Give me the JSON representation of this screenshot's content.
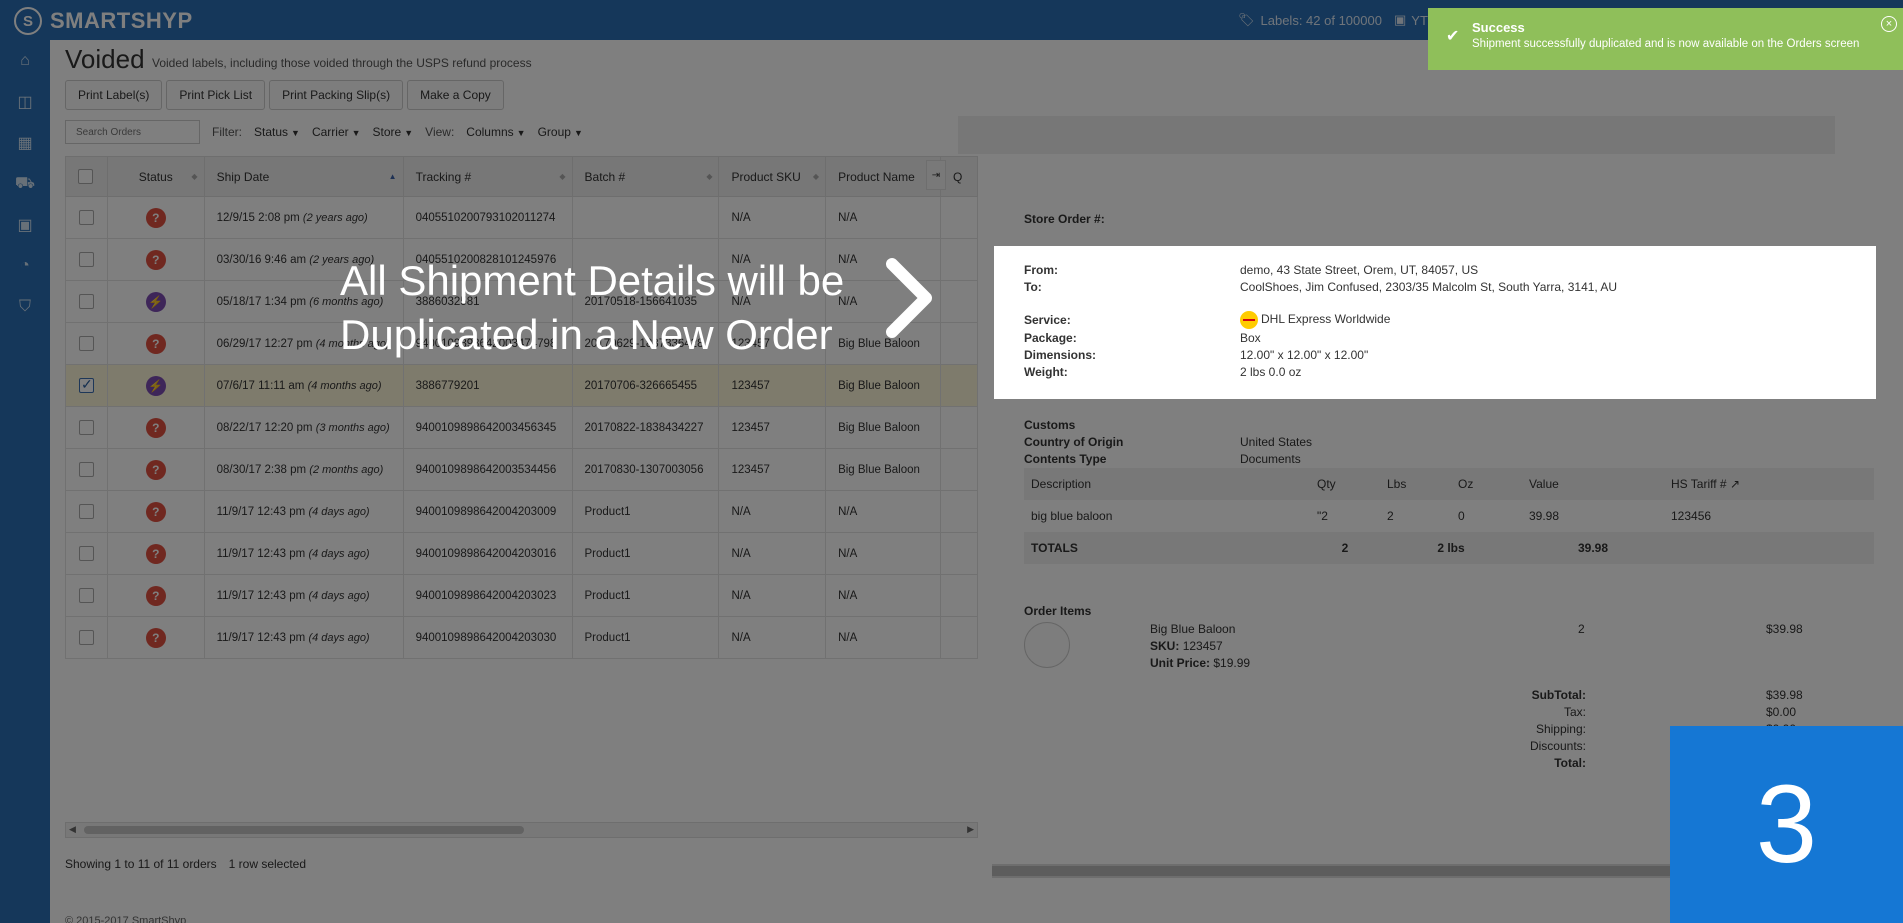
{
  "app": {
    "logo_mark": "S",
    "brand": "SMARTSHYP",
    "labels_count": "Labels: 42 of 100000",
    "cash": "YT",
    "copyright": "© 2015-2017 SmartShyp"
  },
  "sidebar": {
    "items": [
      {
        "name": "home-icon",
        "glyph": "⌂"
      },
      {
        "name": "basket-icon",
        "glyph": "◫"
      },
      {
        "name": "calendar-icon",
        "glyph": "▦"
      },
      {
        "name": "truck-icon",
        "glyph": "⛟"
      },
      {
        "name": "address-book-icon",
        "glyph": "▣"
      },
      {
        "name": "pie-chart-icon",
        "glyph": "◔"
      },
      {
        "name": "cart-icon",
        "glyph": "⛉"
      }
    ]
  },
  "page": {
    "title": "Voided",
    "subtitle": "Voided labels, including those voided through the USPS refund process"
  },
  "toolbar": {
    "print_labels": "Print Label(s)",
    "print_pick": "Print Pick List",
    "print_packing": "Print Packing Slip(s)",
    "make_copy": "Make a Copy"
  },
  "filters": {
    "search_placeholder": "Search Orders",
    "filter_label": "Filter:",
    "status": "Status",
    "carrier": "Carrier",
    "store": "Store",
    "view_label": "View:",
    "columns": "Columns",
    "group": "Group"
  },
  "grid": {
    "headers": [
      "Status",
      "Ship Date",
      "Tracking #",
      "Batch #",
      "Product SKU",
      "Product Name",
      "Q"
    ],
    "rows": [
      {
        "status": "void",
        "date": "12/9/15 2:08 pm",
        "ago": "(2 years ago)",
        "tracking": "0405510200793102011274",
        "batch": "",
        "sku": "N/A",
        "name": "N/A",
        "selected": false
      },
      {
        "status": "void",
        "date": "03/30/16 9:46 am",
        "ago": "(2 years ago)",
        "tracking": "0405510200828101245976",
        "batch": "",
        "sku": "N/A",
        "name": "N/A",
        "selected": false
      },
      {
        "status": "lightning",
        "date": "05/18/17 1:34 pm",
        "ago": "(6 months ago)",
        "tracking": "3886032581",
        "batch": "20170518-156641035",
        "sku": "N/A",
        "name": "N/A",
        "selected": false
      },
      {
        "status": "void",
        "date": "06/29/17 12:27 pm",
        "ago": "(4 months ago)",
        "tracking": "9400109898642003474798",
        "batch": "20170629-1837336428",
        "sku": "123457",
        "name": "Big Blue Baloon",
        "selected": false
      },
      {
        "status": "lightning",
        "date": "07/6/17 11:11 am",
        "ago": "(4 months ago)",
        "tracking": "3886779201",
        "batch": "20170706-326665455",
        "sku": "123457",
        "name": "Big Blue Baloon",
        "selected": true
      },
      {
        "status": "void",
        "date": "08/22/17 12:20 pm",
        "ago": "(3 months ago)",
        "tracking": "9400109898642003456345",
        "batch": "20170822-1838434227",
        "sku": "123457",
        "name": "Big Blue Baloon",
        "selected": false
      },
      {
        "status": "void",
        "date": "08/30/17 2:38 pm",
        "ago": "(2 months ago)",
        "tracking": "9400109898642003534456",
        "batch": "20170830-1307003056",
        "sku": "123457",
        "name": "Big Blue Baloon",
        "selected": false
      },
      {
        "status": "void",
        "date": "11/9/17 12:43 pm",
        "ago": "(4 days ago)",
        "tracking": "9400109898642004203009",
        "batch": "Product1",
        "sku": "N/A",
        "name": "N/A",
        "selected": false
      },
      {
        "status": "void",
        "date": "11/9/17 12:43 pm",
        "ago": "(4 days ago)",
        "tracking": "9400109898642004203016",
        "batch": "Product1",
        "sku": "N/A",
        "name": "N/A",
        "selected": false
      },
      {
        "status": "void",
        "date": "11/9/17 12:43 pm",
        "ago": "(4 days ago)",
        "tracking": "9400109898642004203023",
        "batch": "Product1",
        "sku": "N/A",
        "name": "N/A",
        "selected": false
      },
      {
        "status": "void",
        "date": "11/9/17 12:43 pm",
        "ago": "(4 days ago)",
        "tracking": "9400109898642004203030",
        "batch": "Product1",
        "sku": "N/A",
        "name": "N/A",
        "selected": false
      }
    ]
  },
  "footer": {
    "showing": "Showing 1 to 11 of 11 orders",
    "selected": "1 row selected"
  },
  "detail": {
    "store_order_label": "Store Order #:",
    "from_label": "From:",
    "from_value": "demo, 43 State Street, Orem, UT, 84057, US",
    "to_label": "To:",
    "to_value": "CoolShoes, Jim Confused, 2303/35 Malcolm St, South Yarra, 3141, AU",
    "service_label": "Service:",
    "service_value": "DHL Express Worldwide",
    "package_label": "Package:",
    "package_value": "Box",
    "dimensions_label": "Dimensions:",
    "dimensions_value": "12.00\" x 12.00\" x 12.00\"",
    "weight_label": "Weight:",
    "weight_value": "2 lbs 0.0 oz",
    "customs_label": "Customs",
    "origin_label": "Country of Origin",
    "origin_value": "United States",
    "contents_label": "Contents Type",
    "contents_value": "Documents",
    "customs_headers": [
      "Description",
      "Qty",
      "Lbs",
      "Oz",
      "Value",
      "HS Tariff #"
    ],
    "customs_row": [
      "big blue baloon",
      "\"2",
      "2",
      "0",
      "39.98",
      "123456"
    ],
    "totals_label": "TOTALS",
    "totals_qty": "2",
    "totals_lbs": "2 lbs",
    "totals_value": "39.98",
    "order_items_label": "Order Items",
    "item_name": "Big Blue Baloon",
    "item_sku_label": "SKU:",
    "item_sku": "123457",
    "item_price_label": "Unit Price:",
    "item_price": "$19.99",
    "item_qty": "2",
    "item_total": "$39.98",
    "subtotal_label": "SubTotal:",
    "subtotal": "$39.98",
    "tax_label": "Tax:",
    "tax": "$0.00",
    "shipping_label": "Shipping:",
    "shipping": "$0.00",
    "discounts_label": "Discounts:",
    "total_label": "Total:"
  },
  "overlay": {
    "line1": "All Shipment Details will be",
    "line2": "Duplicated in a New Order",
    "step": "3"
  },
  "toast": {
    "title": "Success",
    "message": "Shipment successfully duplicated and is now available on the Orders screen",
    "close": "×"
  },
  "colors": {
    "brand_blue": "#2a6fb4",
    "toast_green": "#8fbf5a",
    "badge_blue": "#1577d4",
    "void_red": "#e05040",
    "lightning_purple": "#7c4db3"
  }
}
